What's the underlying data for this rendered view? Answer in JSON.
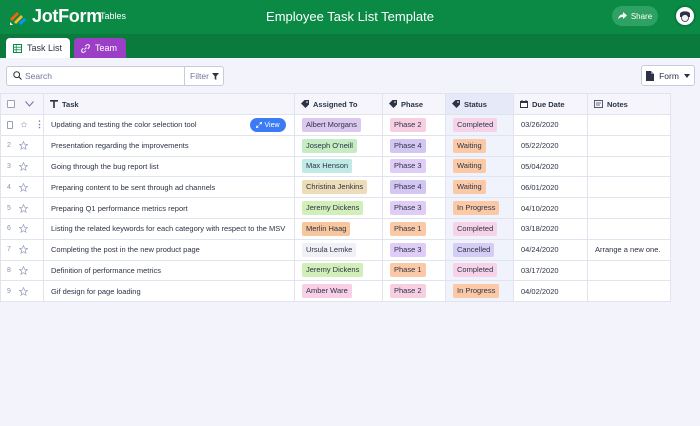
{
  "app": {
    "brand": "JotForm",
    "nav_tables": "Tables",
    "title": "Employee Task List Template",
    "share_label": "Share"
  },
  "tabs": [
    {
      "label": "Task List",
      "color": "#ffffff"
    },
    {
      "label": "Team",
      "color": "#9b3fc7"
    }
  ],
  "toolbar": {
    "search_placeholder": "Search",
    "filter_label": "Filter",
    "form_label": "Form"
  },
  "columns": {
    "task": "Task",
    "assigned": "Assigned To",
    "phase": "Phase",
    "status": "Status",
    "due": "Due Date",
    "notes": "Notes"
  },
  "view_label": "View",
  "rows": [
    {
      "num": "",
      "task": "Updating and testing the color selection tool",
      "assigned": "Albert Morgans",
      "phase": "Phase 2",
      "status": "Completed",
      "due": "03/26/2020",
      "notes": ""
    },
    {
      "num": "2",
      "task": "Presentation regarding the improvements",
      "assigned": "Joseph O'neill",
      "phase": "Phase 4",
      "status": "Waiting",
      "due": "05/22/2020",
      "notes": ""
    },
    {
      "num": "3",
      "task": "Going through the bug report list",
      "assigned": "Max Henson",
      "phase": "Phase 3",
      "status": "Waiting",
      "due": "05/04/2020",
      "notes": ""
    },
    {
      "num": "4",
      "task": "Preparing content to be sent through ad channels",
      "assigned": "Christina Jenkins",
      "phase": "Phase 4",
      "status": "Waiting",
      "due": "06/01/2020",
      "notes": ""
    },
    {
      "num": "5",
      "task": "Preparing Q1 performance metrics report",
      "assigned": "Jeremy Dickens",
      "phase": "Phase 3",
      "status": "In Progress",
      "due": "04/10/2020",
      "notes": ""
    },
    {
      "num": "6",
      "task": "Listing the related keywords for each category with respect to the MSV",
      "assigned": "Merlin Haag",
      "phase": "Phase 1",
      "status": "Completed",
      "due": "03/18/2020",
      "notes": ""
    },
    {
      "num": "7",
      "task": "Completing the post in the new product page",
      "assigned": "Ursula Lemke",
      "phase": "Phase 3",
      "status": "Cancelled",
      "due": "04/24/2020",
      "notes": "Arrange a new one."
    },
    {
      "num": "8",
      "task": "Definition of performance metrics",
      "assigned": "Jeremy Dickens",
      "phase": "Phase 1",
      "status": "Completed",
      "due": "03/17/2020",
      "notes": ""
    },
    {
      "num": "9",
      "task": "Gif design for page loading",
      "assigned": "Amber Ware",
      "phase": "Phase 2",
      "status": "In Progress",
      "due": "04/02/2020",
      "notes": ""
    }
  ],
  "pill_colors": {
    "Albert Morgans": "#dcc8ef",
    "Joseph O'neill": "#c6ecc3",
    "Max Henson": "#bfeae6",
    "Christina Jenkins": "#ecdcb8",
    "Jeremy Dickens": "#d2eeb9",
    "Merlin Haag": "#f7c69c",
    "Ursula Lemke": "#f0f0f6",
    "Amber Ware": "#f8cfe6",
    "Phase 1": "#fbc9a6",
    "Phase 2": "#f8cfe1",
    "Phase 3": "#dfcdf5",
    "Phase 4": "#d3c6f2",
    "Completed": "#f7d3ea",
    "Waiting": "#fbc9a6",
    "In Progress": "#fbc9a6",
    "Cancelled": "#d6cdf4"
  },
  "colors": {
    "header_green": "#0a8a45",
    "tab_bar_green": "#0a7a3d",
    "view_blue": "#3b7cf6"
  }
}
